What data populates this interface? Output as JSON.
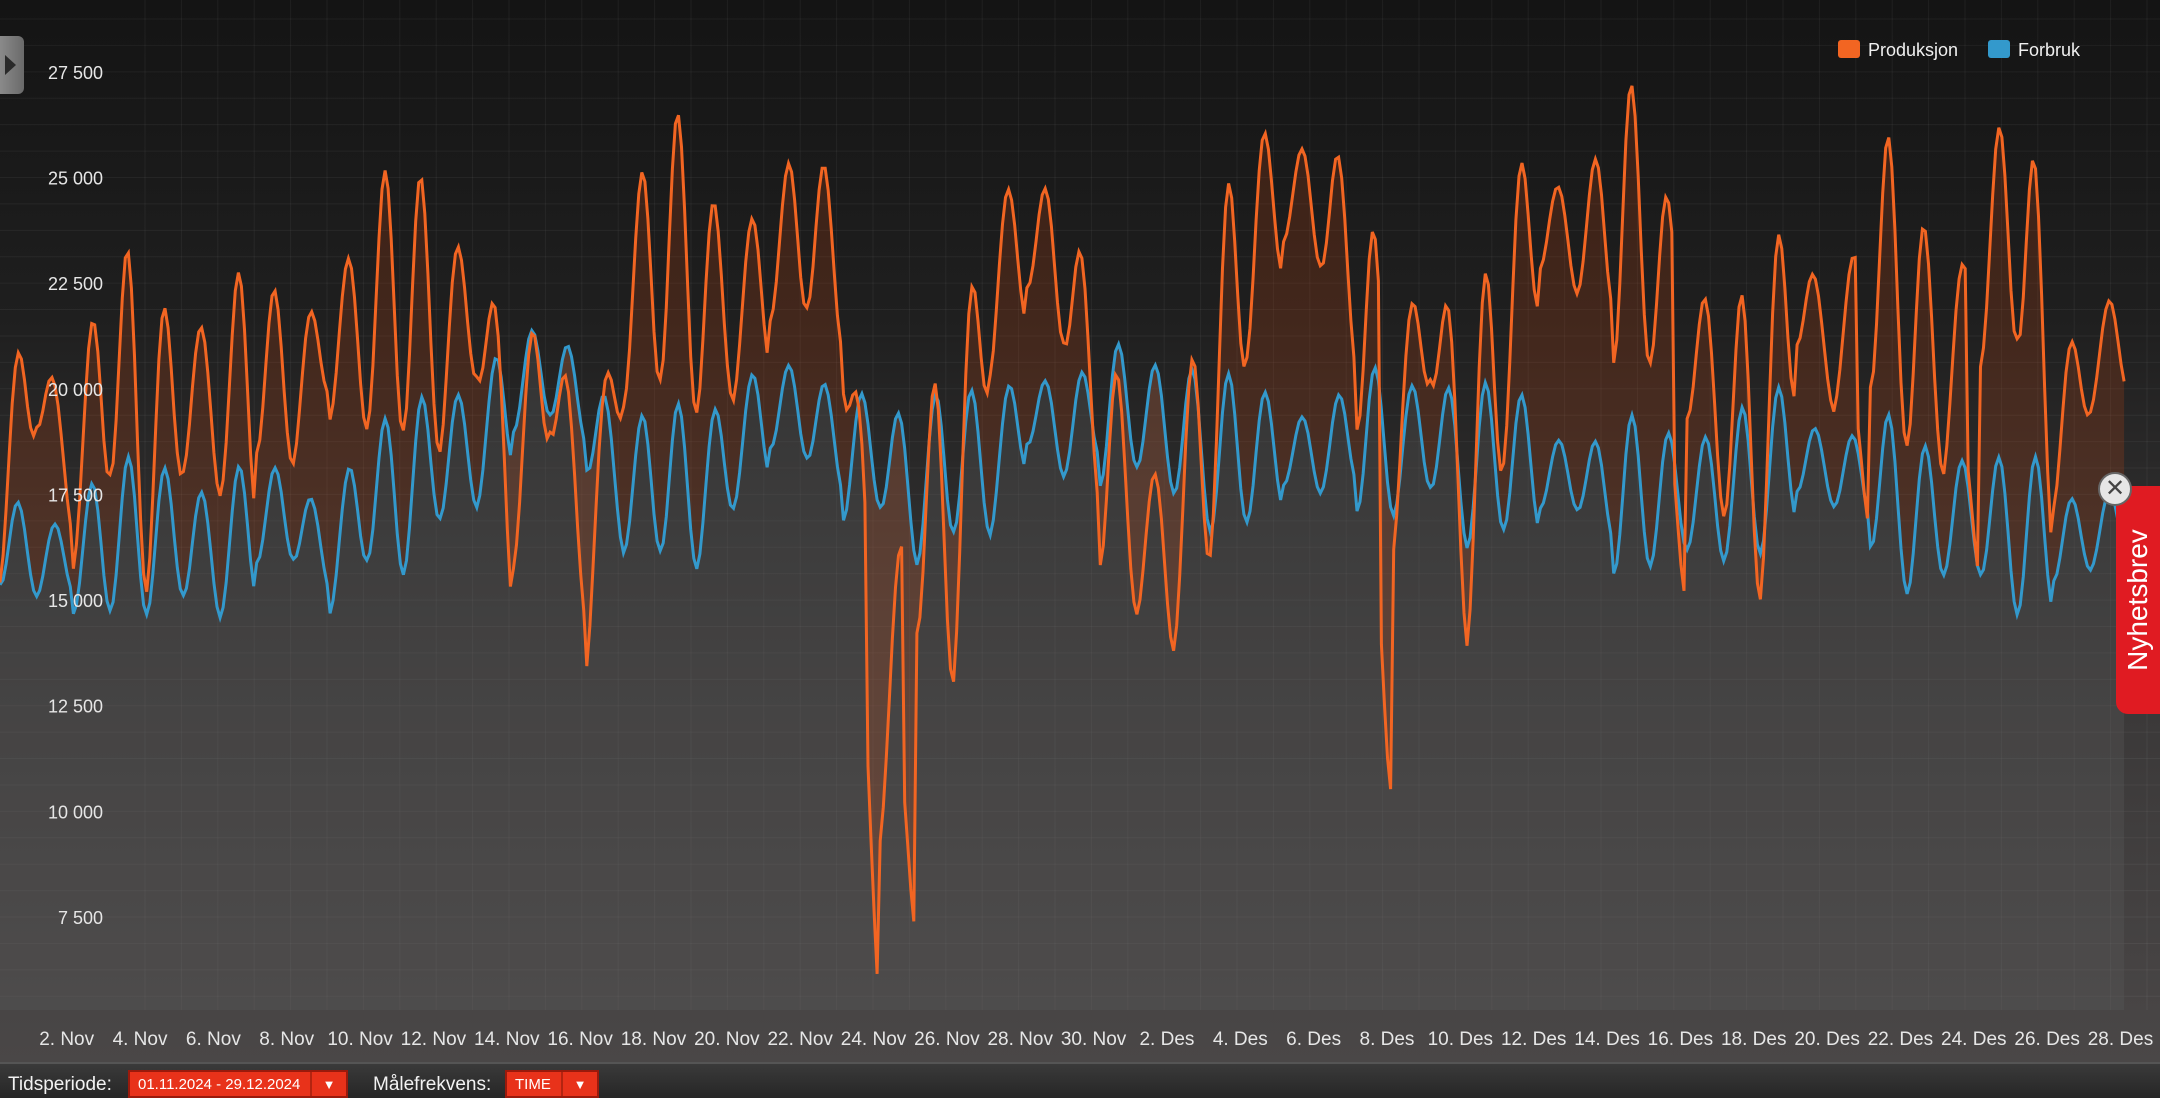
{
  "chart_data": {
    "type": "area",
    "xlabel": "",
    "ylabel": "",
    "x_tick_labels": [
      "2. Nov",
      "4. Nov",
      "6. Nov",
      "8. Nov",
      "10. Nov",
      "12. Nov",
      "14. Nov",
      "16. Nov",
      "18. Nov",
      "20. Nov",
      "22. Nov",
      "24. Nov",
      "26. Nov",
      "28. Nov",
      "30. Nov",
      "2. Des",
      "4. Des",
      "6. Des",
      "8. Des",
      "10. Des",
      "12. Des",
      "14. Des",
      "16. Des",
      "18. Des",
      "20. Des",
      "22. Des",
      "24. Des",
      "26. Des",
      "28. Des"
    ],
    "y_tick_labels": [
      "27 500",
      "25 000",
      "22 500",
      "20 000",
      "17 500",
      "15 000",
      "12 500",
      "10 000",
      "7 500"
    ],
    "y_ticks": [
      27500,
      25000,
      22500,
      20000,
      17500,
      15000,
      12500,
      10000,
      7500
    ],
    "ylim": [
      5300,
      29200
    ],
    "x_range_days": [
      1,
      59.35
    ],
    "grid": true,
    "legend_position": "top-right",
    "legend": [
      "Produksjon",
      "Forbruk"
    ],
    "series": [
      {
        "name": "Produksjon",
        "color": "#f26522",
        "description_note": "daily mean values, MWh",
        "x_day": [
          1,
          2,
          3,
          4,
          5,
          6,
          7,
          8,
          9,
          10,
          11,
          12,
          13,
          14,
          15,
          16,
          17,
          18,
          19,
          20,
          21,
          22,
          23,
          24,
          25,
          26,
          27,
          28,
          29,
          30,
          31,
          32,
          33,
          34,
          35,
          36,
          37,
          38,
          39,
          40,
          41,
          42,
          43,
          44,
          45,
          46,
          47,
          48,
          49,
          50,
          51,
          52,
          53,
          54,
          55,
          56,
          57,
          58,
          59
        ],
        "values": [
          17500,
          20500,
          17500,
          21000,
          18500,
          20000,
          19500,
          20500,
          20000,
          21000,
          21500,
          22500,
          21000,
          22000,
          17500,
          21000,
          15500,
          21500,
          23500,
          22500,
          21500,
          23000,
          24000,
          22500,
          11000,
          17000,
          16500,
          22500,
          23500,
          23000,
          19000,
          16500,
          16000,
          19500,
          23500,
          24500,
          24500,
          22500,
          18500,
          22000,
          17000,
          21500,
          24000,
          23500,
          24000,
          23500,
          21000,
          19500,
          18500,
          22500,
          20500,
          23000,
          22000,
          20000,
          22500,
          24500,
          19000,
          20500,
          21500
        ],
        "peaks": [
          22000,
          22000,
          21600,
          21000,
          21200,
          22400,
          24300,
          25000,
          22500,
          18500,
          24500,
          24600,
          23000,
          25900,
          22700,
          21600,
          24500,
          25000,
          24600,
          21000,
          25000,
          25200,
          25000,
          23300,
          25500,
          24800,
          24500,
          22500,
          25800,
          25000,
          25700,
          26400,
          20300,
          24100,
          21700
        ]
      },
      {
        "name": "Forbruk",
        "color": "#3399cc",
        "values": [
          16500,
          16000,
          16000,
          16500,
          16500,
          16500,
          16000,
          17000,
          17000,
          16000,
          17500,
          17500,
          18500,
          18500,
          20000,
          20500,
          19500,
          17500,
          18000,
          17500,
          18500,
          19500,
          19500,
          18500,
          18500,
          17500,
          18500,
          18000,
          19500,
          19000,
          19500,
          19500,
          19000,
          18500,
          18500,
          18500,
          18500,
          19000,
          18500,
          19000,
          18000,
          18500,
          18000,
          18000,
          17500,
          17500,
          17500,
          17500,
          18000,
          18500,
          18000,
          18000,
          17000,
          17000,
          17000,
          16500,
          16500,
          16500,
          17000
        ]
      }
    ]
  },
  "controls": {
    "period_label": "Tidsperiode:",
    "period_value": "01.11.2024 - 29.12.2024",
    "frequency_label": "Målefrekvens:",
    "frequency_value": "TIME"
  },
  "newsletter": {
    "label": "Nyhetsbrev"
  },
  "icons": {
    "side_toggle": "chevron-right-icon",
    "dropdown": "caret-down-icon",
    "close": "close-icon"
  }
}
